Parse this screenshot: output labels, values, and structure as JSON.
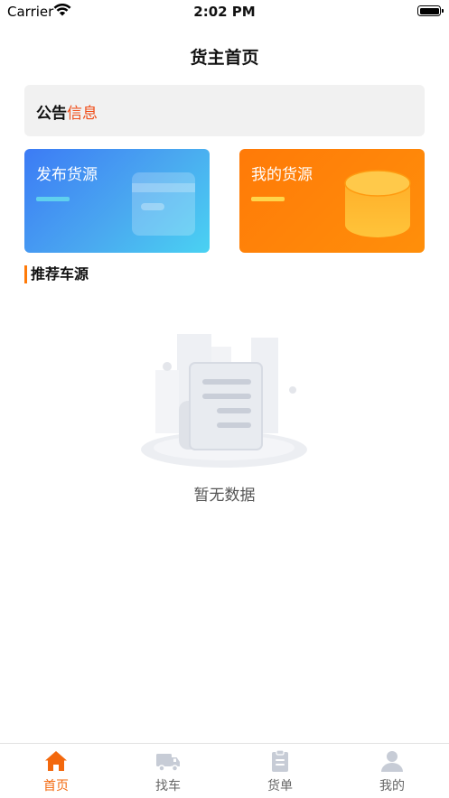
{
  "status_bar": {
    "carrier": "Carrier",
    "time": "2:02 PM"
  },
  "header": {
    "title": "货主首页"
  },
  "notice": {
    "label_a": "公告",
    "label_b": "信息"
  },
  "cards": [
    {
      "label": "发布货源"
    },
    {
      "label": "我的货源"
    }
  ],
  "section": {
    "title": "推荐车源"
  },
  "empty": {
    "text": "暂无数据"
  },
  "tabbar": {
    "items": [
      {
        "label": "首页",
        "icon": "home-icon",
        "active": true
      },
      {
        "label": "找车",
        "icon": "truck-icon",
        "active": false
      },
      {
        "label": "货单",
        "icon": "clipboard-icon",
        "active": false
      },
      {
        "label": "我的",
        "icon": "user-icon",
        "active": false
      }
    ]
  },
  "colors": {
    "accent": "#f3680d",
    "notice_highlight": "#f04e1a",
    "blue_card": "#3c7bf5",
    "orange_card": "#ff7a08"
  }
}
